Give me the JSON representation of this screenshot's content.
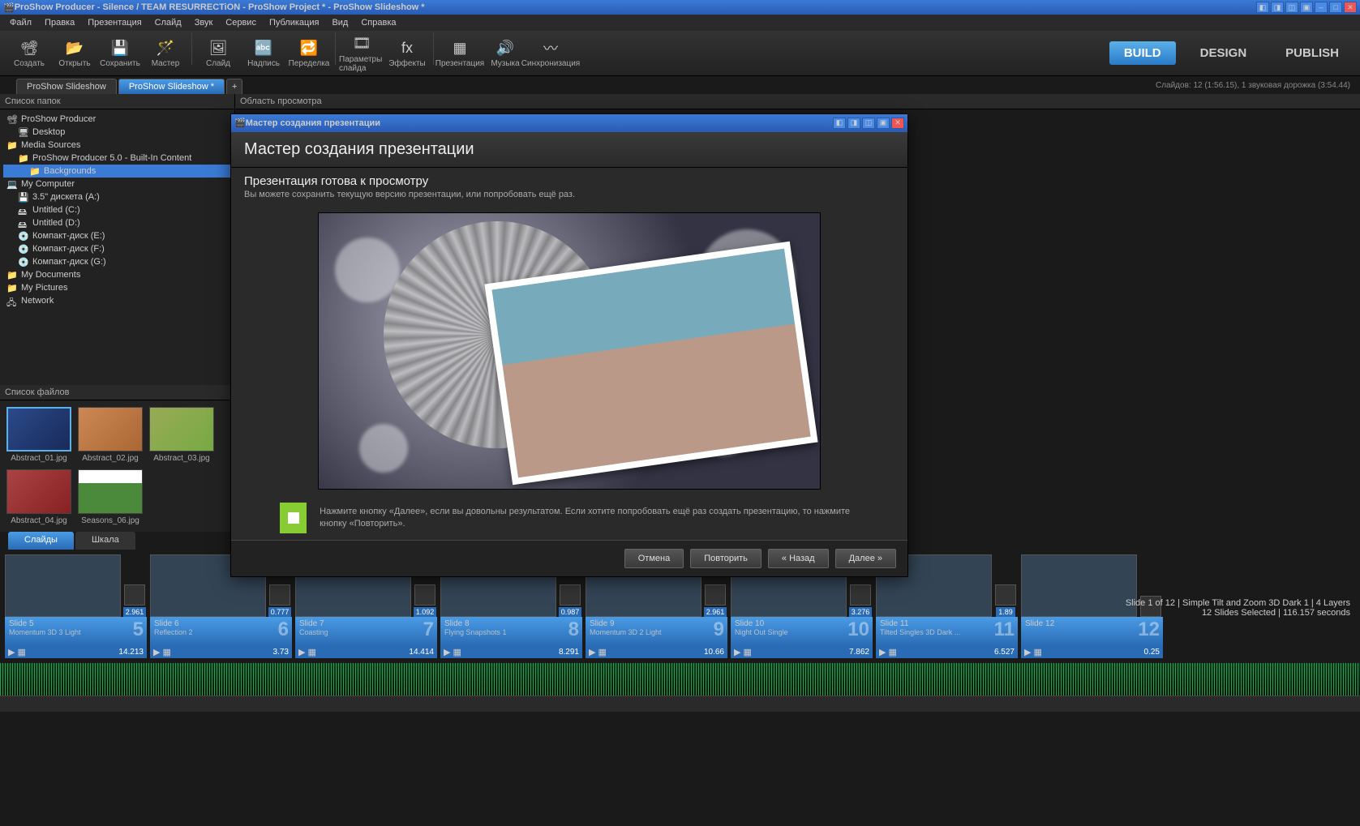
{
  "app": {
    "title": "ProShow Producer - Silence / TEAM RESURRECTiON - ProShow Project * - ProShow Slideshow *"
  },
  "menu": [
    "Файл",
    "Правка",
    "Презентация",
    "Слайд",
    "Звук",
    "Сервис",
    "Публикация",
    "Вид",
    "Справка"
  ],
  "toolbar": [
    {
      "label": "Создать",
      "icon": "📽"
    },
    {
      "label": "Открыть",
      "icon": "📂"
    },
    {
      "label": "Сохранить",
      "icon": "💾"
    },
    {
      "label": "Мастер",
      "icon": "🪄"
    },
    {
      "label": "Слайд",
      "icon": "🖼"
    },
    {
      "label": "Надпись",
      "icon": "🔤"
    },
    {
      "label": "Переделка",
      "icon": "🔁"
    },
    {
      "label": "Параметры слайда",
      "icon": "🎞"
    },
    {
      "label": "Эффекты",
      "icon": "fx"
    },
    {
      "label": "Презентация",
      "icon": "▦"
    },
    {
      "label": "Музыка",
      "icon": "🔊"
    },
    {
      "label": "Синхронизация",
      "icon": "〰"
    }
  ],
  "modes": {
    "build": "BUILD",
    "design": "DESIGN",
    "publish": "PUBLISH"
  },
  "tabs": [
    {
      "label": "ProShow Slideshow",
      "active": false
    },
    {
      "label": "ProShow Slideshow *",
      "active": true
    }
  ],
  "status": "Слайдов: 12 (1:56.15), 1 звуковая дорожка (3:54.44)",
  "panels": {
    "folders": "Список папок",
    "files": "Список файлов",
    "preview": "Область просмотра"
  },
  "tree": [
    {
      "label": "ProShow Producer",
      "depth": 0,
      "icon": "📽"
    },
    {
      "label": "Desktop",
      "depth": 1,
      "icon": "🖥"
    },
    {
      "label": "Media Sources",
      "depth": 0,
      "icon": "📁"
    },
    {
      "label": "ProShow Producer 5.0 - Built-In Content",
      "depth": 1,
      "icon": "📁"
    },
    {
      "label": "Backgrounds",
      "depth": 2,
      "icon": "📁",
      "sel": true
    },
    {
      "label": "My Computer",
      "depth": 0,
      "icon": "💻"
    },
    {
      "label": "3.5\" дискета (A:)",
      "depth": 1,
      "icon": "💾"
    },
    {
      "label": "Untitled (C:)",
      "depth": 1,
      "icon": "🖴"
    },
    {
      "label": "Untitled (D:)",
      "depth": 1,
      "icon": "🖴"
    },
    {
      "label": "Компакт-диск (E:)",
      "depth": 1,
      "icon": "💿"
    },
    {
      "label": "Компакт-диск (F:)",
      "depth": 1,
      "icon": "💿"
    },
    {
      "label": "Компакт-диск (G:)",
      "depth": 1,
      "icon": "💿"
    },
    {
      "label": "My Documents",
      "depth": 0,
      "icon": "📁"
    },
    {
      "label": "My Pictures",
      "depth": 0,
      "icon": "📁"
    },
    {
      "label": "Network",
      "depth": 0,
      "icon": "🖧"
    }
  ],
  "files": [
    {
      "name": "Abstract_01.jpg",
      "sel": true,
      "bg": "linear-gradient(135deg,#2a4a8a,#1a2a5a)"
    },
    {
      "name": "Abstract_02.jpg",
      "bg": "linear-gradient(135deg,#c85,#a63)"
    },
    {
      "name": "Abstract_03.jpg",
      "bg": "linear-gradient(135deg,#9a5,#7a4)"
    },
    {
      "name": "Abstract_04.jpg",
      "bg": "linear-gradient(135deg,#a44,#822)"
    },
    {
      "name": "Seasons_06.jpg",
      "bg": "linear-gradient(180deg,#fff 30%,#4a8a3a 30%)"
    }
  ],
  "preview_info": {
    "line1": "Slide 1 of 12  |  Simple Tilt and Zoom 3D Dark 1  |  4 Layers",
    "line2": "12 Slides Selected  |  116.157 seconds"
  },
  "tl_tabs": {
    "slides": "Слайды",
    "scale": "Шкала"
  },
  "slides": [
    {
      "num": 5,
      "name": "Slide 5",
      "effect": "Momentum 3D 3 Light",
      "dur": "14.213",
      "trans": "2.961"
    },
    {
      "num": 6,
      "name": "Slide 6",
      "effect": "Reflection 2",
      "dur": "3.73",
      "trans": "0.777"
    },
    {
      "num": 7,
      "name": "Slide 7",
      "effect": "Coasting",
      "dur": "14.414",
      "trans": "1.092"
    },
    {
      "num": 8,
      "name": "Slide 8",
      "effect": "Flying Snapshots 1",
      "dur": "8.291",
      "trans": "0.987"
    },
    {
      "num": 9,
      "name": "Slide 9",
      "effect": "Momentum 3D 2 Light",
      "dur": "10.66",
      "trans": "2.961"
    },
    {
      "num": 10,
      "name": "Slide 10",
      "effect": "Night Out Single",
      "dur": "7.862",
      "trans": "3.276"
    },
    {
      "num": 11,
      "name": "Slide 11",
      "effect": "Tilted Singles 3D Dark ...",
      "dur": "6.527",
      "trans": "1.89"
    },
    {
      "num": 12,
      "name": "Slide 12",
      "effect": "",
      "dur": "0.25",
      "trans": ""
    }
  ],
  "dialog": {
    "window_title": "Мастер создания презентации",
    "header": "Мастер создания презентации",
    "subtitle": "Презентация готова к просмотру",
    "note": "Вы можете сохранить текущую версию презентации, или попробовать ещё раз.",
    "hint": "Нажмите кнопку «Далее», если вы довольны результатом. Если хотите попробовать ещё раз создать презентацию, то нажмите кнопку «Повторить».",
    "btns": {
      "cancel": "Отмена",
      "retry": "Повторить",
      "back": "« Назад",
      "next": "Далее »"
    }
  }
}
